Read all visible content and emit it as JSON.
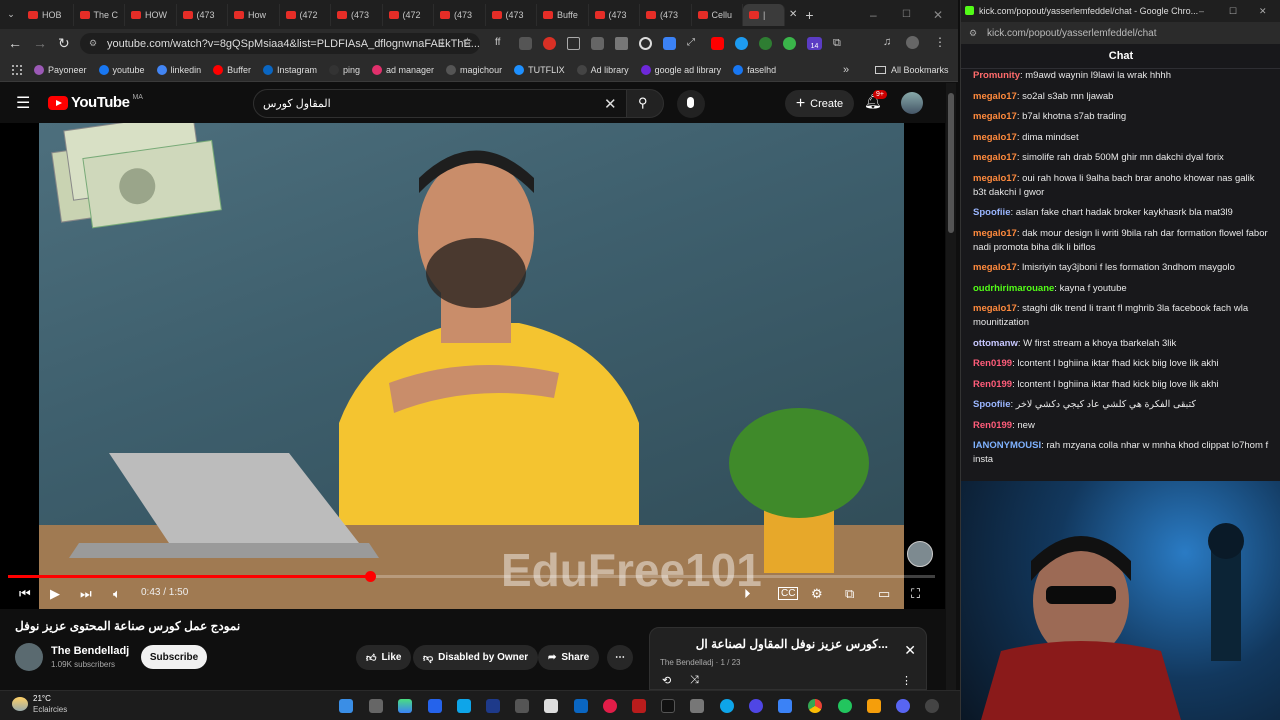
{
  "browser_left": {
    "tabs": [
      {
        "label": "HOB"
      },
      {
        "label": "The C"
      },
      {
        "label": "HOW"
      },
      {
        "label": "(473"
      },
      {
        "label": "How"
      },
      {
        "label": "(472"
      },
      {
        "label": "(473"
      },
      {
        "label": "(472"
      },
      {
        "label": "(473"
      },
      {
        "label": "(473"
      },
      {
        "label": "Buffe"
      },
      {
        "label": "(473"
      },
      {
        "label": "(473"
      },
      {
        "label": "Cellu"
      },
      {
        "label": "|"
      }
    ],
    "url": "youtube.com/watch?v=8gQSpMsiaa4&list=PLDFIAsA_dflognwnaFAEkThE...",
    "bookmarks": [
      "Payoneer",
      "youtube",
      "linkedin",
      "Buffer",
      "Instagram",
      "ping",
      "ad manager",
      "magichour",
      "TUTFLIX",
      "Ad library",
      "google ad library",
      "faselhd"
    ],
    "all_bookmarks": "All Bookmarks",
    "extension_badge": "14"
  },
  "youtube": {
    "logo_text": "YouTube",
    "region": "MA",
    "search_value": "المقاول كورس",
    "create_label": "Create",
    "notif_count": "9+",
    "video_watermark": "EduFree101",
    "time": "0:43 / 1:50",
    "progress": 0.39,
    "title": "نمودج عمل كورس صناعة المحتوى عزيز نوفل",
    "channel_name": "The Bendelladj",
    "subscribers": "1.09K subscribers",
    "subscribe_label": "Subscribe",
    "like_label": "Like",
    "dislike_label": "Disabled by Owner",
    "share_label": "Share",
    "playlist_title": "كورس عزيز نوفل المقاول لصناعة ال...",
    "playlist_meta": "The Bendelladj · 1 / 23"
  },
  "taskbar": {
    "temp": "21°C",
    "weather": "Eclaircies"
  },
  "browser_right": {
    "title": "kick.com/popout/yasserlemfeddel/chat - Google Chro...",
    "url": "kick.com/popout/yasserlemfeddel/chat",
    "chat_header": "Chat",
    "messages": [
      {
        "user": "Promunity",
        "text": "m9awd waynin l9lawi la wrak hhhh",
        "color": "#ff6b6b"
      },
      {
        "user": "megalo17",
        "text": "so2al s3ab mn ljawab",
        "color": "#ff8a3d"
      },
      {
        "user": "megalo17",
        "text": "b7al khotna s7ab trading",
        "color": "#ff8a3d"
      },
      {
        "user": "megalo17",
        "text": "dima mindset",
        "color": "#ff8a3d"
      },
      {
        "user": "megalo17",
        "text": "simolife rah drab 500M ghir mn dakchi dyal forix",
        "color": "#ff8a3d"
      },
      {
        "user": "megalo17",
        "text": "oui rah howa li 9alha bach brar anoho khowar nas galik b3t dakchi l gwor",
        "color": "#ff8a3d"
      },
      {
        "user": "Spoofiie",
        "text": "aslan fake chart hadak broker kaykhasrk bla mat3l9",
        "color": "#9ab6ff"
      },
      {
        "user": "megalo17",
        "text": "dak mour design li writi 9bila rah dar formation flowel fabor nadi promota biha dik li biflos",
        "color": "#ff8a3d"
      },
      {
        "user": "megalo17",
        "text": "lmisriyin tay3jboni f les formation 3ndhom maygolo",
        "color": "#ff8a3d"
      },
      {
        "user": "oudrhirimarouane",
        "text": "kayna f youtube",
        "color": "#53fc18"
      },
      {
        "user": "megalo17",
        "text": "staghi dik trend li trant fl mghrib 3la facebook fach wla mounitization",
        "color": "#ff8a3d"
      },
      {
        "user": "ottomanw",
        "text": "W first stream a khoya tbarkelah 3lik",
        "color": "#c8c8ff"
      },
      {
        "user": "Ren0199",
        "text": "lcontent l bghiina iktar fhad kick biig love lik akhi",
        "color": "#ff5c7a"
      },
      {
        "user": "Ren0199",
        "text": "lcontent l bghiina iktar fhad kick biig love lik akhi",
        "color": "#ff5c7a"
      },
      {
        "user": "Spoofiie",
        "text": "كتبقى الفكرة هي كلشي عاد كيجي دكشي لاخر",
        "color": "#9ab6ff"
      },
      {
        "user": "Ren0199",
        "text": "new",
        "color": "#ff5c7a"
      },
      {
        "user": "IANONYMOUSI",
        "text": "rah mzyana colla nhar w mnha khod clippat lo7hom f insta",
        "color": "#7fb2ff"
      }
    ]
  }
}
